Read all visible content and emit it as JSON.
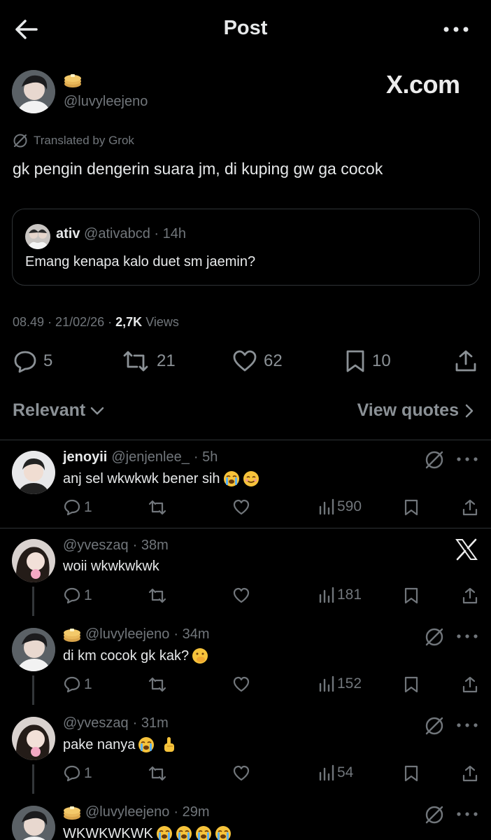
{
  "header": {
    "back_icon": "arrow-left-icon",
    "title": "Post",
    "more_icon": "more-horizontal-icon"
  },
  "post": {
    "handle": "@luvyleejeno",
    "name_emoji": "pancakes-emoji",
    "watermark": "X.com",
    "translated_label": "Translated by Grok",
    "text": "gk pengin dengerin suara jm, di kuping gw ga cocok",
    "quote": {
      "name": "ativ",
      "handle": "@ativabcd",
      "time": "· 14h",
      "text": "Emang kenapa kalo duet sm jaemin?"
    },
    "meta": {
      "time": "08.49",
      "date": "· 21/02/26 ·",
      "views_count": "2,7K",
      "views_label": "Views"
    },
    "actions": {
      "replies": "5",
      "reposts": "21",
      "likes": "62",
      "bookmarks": "10"
    }
  },
  "sort": {
    "relevant_label": "Relevant",
    "view_quotes_label": "View quotes"
  },
  "replies": [
    {
      "name": "jenoyii",
      "handle": "@jenjenlee_",
      "time": "· 5h",
      "text": "anj sel wkwkwk bener sih",
      "emojis": [
        "loudly-crying-face-emoji",
        "smiling-face-emoji"
      ],
      "replies": "1",
      "views": "590"
    },
    {
      "name": "",
      "handle": "@yveszaq",
      "time": "· 38m",
      "text": "woii wkwkwkwk",
      "emojis": [],
      "replies": "1",
      "views": "181"
    },
    {
      "name": "",
      "handle": "@luvyleejeno",
      "time": "· 34m",
      "text": "di km cocok gk kak?",
      "emojis": [
        "face-with-hand-over-mouth-emoji"
      ],
      "replies": "1",
      "views": "152"
    },
    {
      "name": "",
      "handle": "@yveszaq",
      "time": "· 31m",
      "text": "pake nanya",
      "emojis": [
        "loudly-crying-face-emoji",
        "index-pointing-up-emoji"
      ],
      "replies": "1",
      "views": "54"
    },
    {
      "name": "",
      "handle": "@luvyleejeno",
      "time": "· 29m",
      "text": "WKWKWKWK",
      "emojis": [
        "loudly-crying-face-emoji",
        "loudly-crying-face-emoji",
        "loudly-crying-face-emoji",
        "loudly-crying-face-emoji"
      ],
      "replies": "",
      "views": ""
    }
  ],
  "colors": {
    "background": "#000000",
    "text": "#e7e9ea",
    "muted": "#71767b",
    "border": "#2f3336"
  }
}
